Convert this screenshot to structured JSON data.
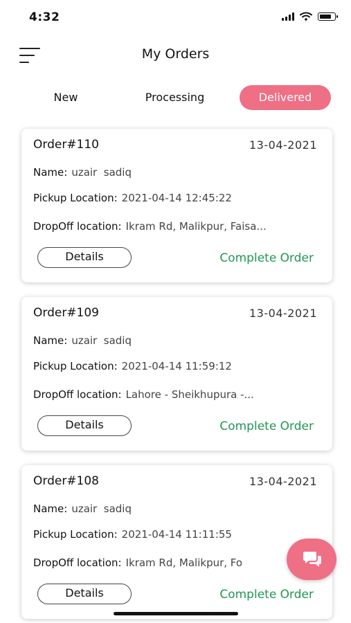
{
  "status": {
    "time": "4:32"
  },
  "header": {
    "title": "My Orders"
  },
  "tabs": {
    "new": "New",
    "processing": "Processing",
    "delivered": "Delivered"
  },
  "orders": [
    {
      "number": "Order#110",
      "date": "13-04-2021",
      "name_label": "Name:",
      "name": "uzair  sadiq",
      "pickup_label": "Pickup Location:",
      "pickup": "2021-04-14 12:45:22",
      "dropoff_label": "DropOff location:",
      "dropoff": "Ikram Rd, Malikpur, Faisa...",
      "details_label": "Details",
      "complete_label": "Complete Order"
    },
    {
      "number": "Order#109",
      "date": "13-04-2021",
      "name_label": "Name:",
      "name": "uzair  sadiq",
      "pickup_label": "Pickup Location:",
      "pickup": "2021-04-14 11:59:12",
      "dropoff_label": "DropOff location:",
      "dropoff": "Lahore - Sheikhupura -...",
      "details_label": "Details",
      "complete_label": "Complete Order"
    },
    {
      "number": "Order#108",
      "date": "13-04-2021",
      "name_label": "Name:",
      "name": "uzair  sadiq",
      "pickup_label": "Pickup Location:",
      "pickup": "2021-04-14 11:11:55",
      "dropoff_label": "DropOff location:",
      "dropoff": "Ikram Rd, Malikpur, Fo",
      "details_label": "Details",
      "complete_label": "Complete Order"
    }
  ],
  "colors": {
    "accent": "#ef6f85",
    "complete": "#219653"
  },
  "icons": {
    "menu": "menu-icon",
    "chat": "chat-icon",
    "wifi": "wifi-icon",
    "battery": "battery-icon",
    "signal": "signal-icon"
  }
}
